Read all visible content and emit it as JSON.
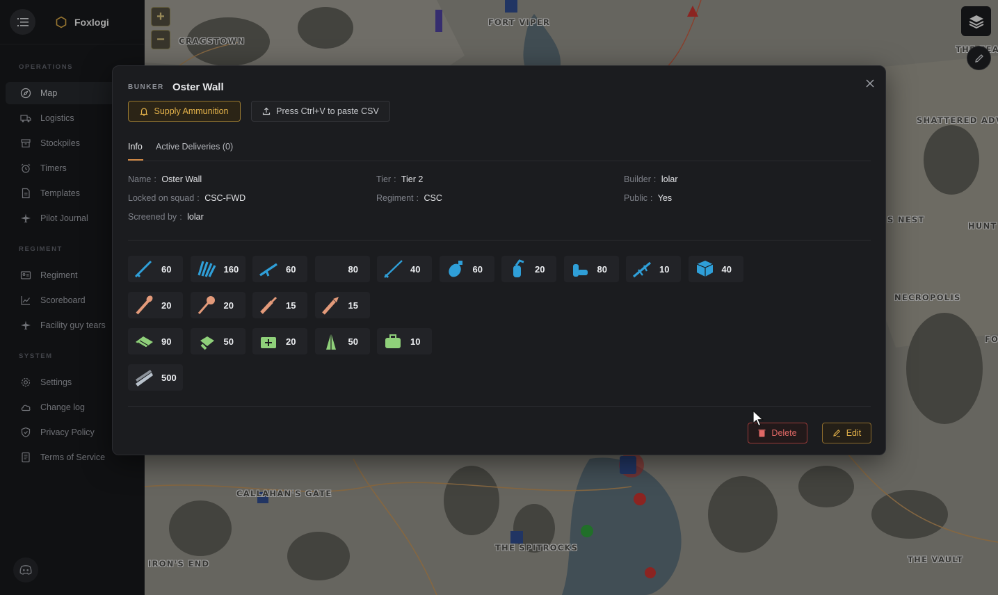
{
  "app": {
    "name": "Foxlogi"
  },
  "sidebar": {
    "sections": [
      {
        "title": "OPERATIONS",
        "items": [
          {
            "label": "Map",
            "icon": "compass-icon",
            "active": true
          },
          {
            "label": "Logistics",
            "icon": "truck-icon"
          },
          {
            "label": "Stockpiles",
            "icon": "archive-icon"
          },
          {
            "label": "Timers",
            "icon": "alarm-icon"
          },
          {
            "label": "Templates",
            "icon": "file-icon"
          },
          {
            "label": "Pilot Journal",
            "icon": "plane-icon"
          }
        ]
      },
      {
        "title": "REGIMENT",
        "items": [
          {
            "label": "Regiment",
            "icon": "id-card-icon"
          },
          {
            "label": "Scoreboard",
            "icon": "chart-line-icon"
          },
          {
            "label": "Facility guy tears",
            "icon": "plane-icon"
          }
        ]
      },
      {
        "title": "SYSTEM",
        "items": [
          {
            "label": "Settings",
            "icon": "gear-icon"
          },
          {
            "label": "Change log",
            "icon": "cloud-icon"
          },
          {
            "label": "Privacy Policy",
            "icon": "shield-icon"
          },
          {
            "label": "Terms of Service",
            "icon": "document-icon"
          }
        ]
      }
    ]
  },
  "map": {
    "labels": [
      "CRAGSTOWN",
      "FORT VIPER",
      "THE FEA",
      "SHATTERED ADV",
      "S NEST",
      "HUNT",
      "NECROPOLIS",
      "FO",
      "CALLAHAN'S GATE",
      "THE SPITROCKS",
      "IRON'S END",
      "THE VAULT"
    ],
    "zoom_in": "+",
    "zoom_out": "−"
  },
  "modal": {
    "kind": "BUNKER",
    "title": "Oster Wall",
    "supply_button": "Supply Ammunition",
    "paste_button": "Press Ctrl+V to paste CSV",
    "tabs": [
      "Info",
      "Active Deliveries (0)"
    ],
    "fields": {
      "name": {
        "key": "Name",
        "value": "Oster Wall"
      },
      "tier": {
        "key": "Tier",
        "value": "Tier 2"
      },
      "builder": {
        "key": "Builder",
        "value": "lolar"
      },
      "locked": {
        "key": "Locked on squad",
        "value": "CSC-FWD"
      },
      "regiment": {
        "key": "Regiment",
        "value": "CSC"
      },
      "public": {
        "key": "Public",
        "value": "Yes"
      },
      "screened": {
        "key": "Screened by",
        "value": "lolar"
      }
    },
    "resources": [
      {
        "icon": "rifle-icon",
        "qty": "60",
        "color": "#2f9fd8"
      },
      {
        "icon": "ammo-belt-icon",
        "qty": "160",
        "color": "#2f9fd8"
      },
      {
        "icon": "smg-icon",
        "qty": "60",
        "color": "#2f9fd8"
      },
      {
        "icon": "shotgun-icon",
        "qty": "80",
        "color": "#2f9fd8"
      },
      {
        "icon": "long-rifle-icon",
        "qty": "40",
        "color": "#2f9fd8"
      },
      {
        "icon": "grenade-icon",
        "qty": "60",
        "color": "#2f9fd8"
      },
      {
        "icon": "gas-grenade-icon",
        "qty": "20",
        "color": "#2f9fd8"
      },
      {
        "icon": "mortar-shells-icon",
        "qty": "80",
        "color": "#2f9fd8"
      },
      {
        "icon": "machine-gun-icon",
        "qty": "10",
        "color": "#2f9fd8"
      },
      {
        "icon": "crate-icon",
        "qty": "40",
        "color": "#2f9fd8"
      },
      {
        "icon": "rpg-icon",
        "qty": "20",
        "color": "#e39a7a"
      },
      {
        "icon": "mace-icon",
        "qty": "20",
        "color": "#e39a7a"
      },
      {
        "icon": "rocket-icon",
        "qty": "15",
        "color": "#e39a7a"
      },
      {
        "icon": "flare-icon",
        "qty": "15",
        "color": "#e39a7a"
      },
      {
        "icon": "bandage-icon",
        "qty": "90",
        "color": "#8fd07a"
      },
      {
        "icon": "trauma-kit-icon",
        "qty": "50",
        "color": "#8fd07a"
      },
      {
        "icon": "medkit-icon",
        "qty": "20",
        "color": "#8fd07a"
      },
      {
        "icon": "plasma-icon",
        "qty": "50",
        "color": "#8fd07a"
      },
      {
        "icon": "supply-bag-icon",
        "qty": "10",
        "color": "#8fd07a"
      },
      {
        "icon": "steel-beams-icon",
        "qty": "500",
        "color": "#b9c2cc"
      }
    ],
    "delete_button": "Delete",
    "edit_button": "Edit"
  }
}
